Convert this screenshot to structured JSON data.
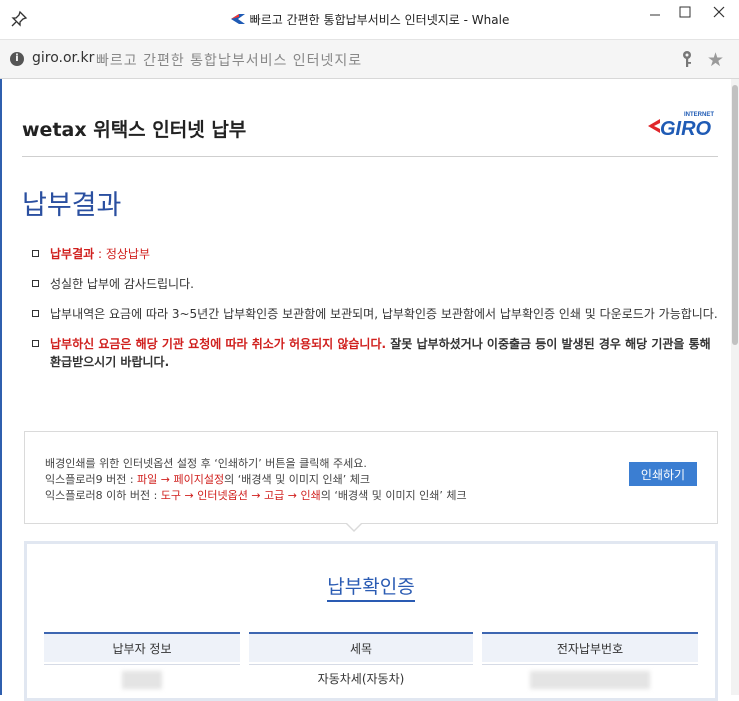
{
  "window": {
    "title": "빠르고 간편한 통합납부서비스 인터넷지로 - Whale"
  },
  "address_bar": {
    "domain": "giro.or.kr",
    "page_title": "빠르고 간편한 통합납부서비스 인터넷지로"
  },
  "header": {
    "site_name": "wetax 위택스 인터넷 납부",
    "logo_small": "INTERNET",
    "logo_main": "GIRO"
  },
  "result": {
    "heading": "납부결과",
    "notes": [
      {
        "label": "납부결과",
        "sep": " : ",
        "value": "정상납부"
      },
      {
        "text": "성실한 납부에 감사드립니다."
      },
      {
        "text": "납부내역은 요금에 따라 3~5년간 납부확인증 보관함에 보관되며, 납부확인증 보관함에서 납부확인증 인쇄 및 다운로드가 가능합니다."
      },
      {
        "red": "납부하신 요금은 해당 기관 요청에 따라 취소가 허용되지 않습니다.",
        "rest": " 잘못 납부하셨거나 이중출금 등이 발생된 경우 해당 기관을 통해 환급받으시기 바랍니다."
      }
    ]
  },
  "print_box": {
    "line1": "배경인쇄를 위한 인터넷옵션 설정 후 ‘인쇄하기’ 버튼을 클릭해 주세요.",
    "line2_pre": "익스플로러9 버전 : ",
    "line2_red": "파일 → 페이지설정",
    "line2_post": "의 ‘배경색 및 이미지 인쇄’ 체크",
    "line3_pre": "익스플로러8 이하 버전 : ",
    "line3_red1": "도구 → 인터넷옵션 → 고급 → 인쇄",
    "line3_post": "의 ‘배경색 및 이미지 인쇄’ 체크",
    "button": "인쇄하기"
  },
  "certificate": {
    "title": "납부확인증",
    "columns": [
      "납부자 정보",
      "세목",
      "전자납부번호"
    ],
    "row": [
      "",
      "자동차세(자동차)",
      ""
    ]
  },
  "colors": {
    "accent": "#2a4fa0",
    "warning": "#d0201e",
    "button": "#3b7ed2"
  }
}
